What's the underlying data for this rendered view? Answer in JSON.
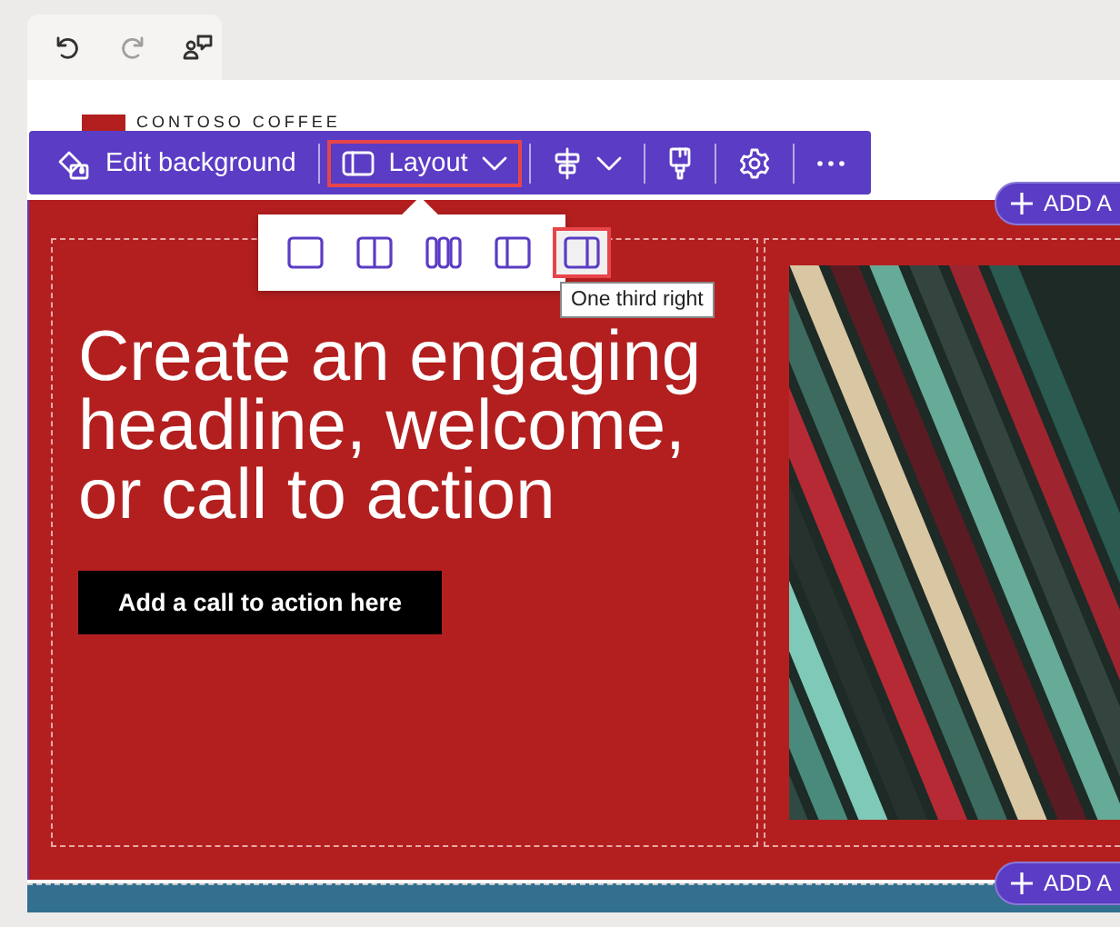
{
  "history_toolbar": {
    "buttons": [
      {
        "kind": "undo",
        "disabled": false
      },
      {
        "kind": "redo",
        "disabled": true
      },
      {
        "kind": "comments",
        "disabled": false
      }
    ]
  },
  "logo": {
    "text": "CONTOSO COFFEE"
  },
  "section_toolbar": {
    "items": [
      {
        "kind": "edit_background",
        "label": "Edit background",
        "selected": false
      },
      {
        "kind": "layout",
        "label": "Layout",
        "selected": true
      },
      {
        "kind": "align",
        "selected": false
      },
      {
        "kind": "brush",
        "selected": false
      },
      {
        "kind": "settings",
        "selected": false
      },
      {
        "kind": "more",
        "selected": false
      }
    ]
  },
  "layout_options": [
    {
      "kind": "one_column",
      "selected": false
    },
    {
      "kind": "two_columns",
      "selected": false
    },
    {
      "kind": "three_columns",
      "selected": false
    },
    {
      "kind": "one_third_left",
      "selected": false
    },
    {
      "kind": "one_third_right",
      "selected": true
    }
  ],
  "tooltip": "One third right",
  "hero": {
    "headline": "Create an engaging headline, welcome, or call to action",
    "button": "Add a call to action here"
  },
  "add_section_buttons": [
    {
      "label": "ADD A"
    },
    {
      "label": "ADD A"
    }
  ]
}
